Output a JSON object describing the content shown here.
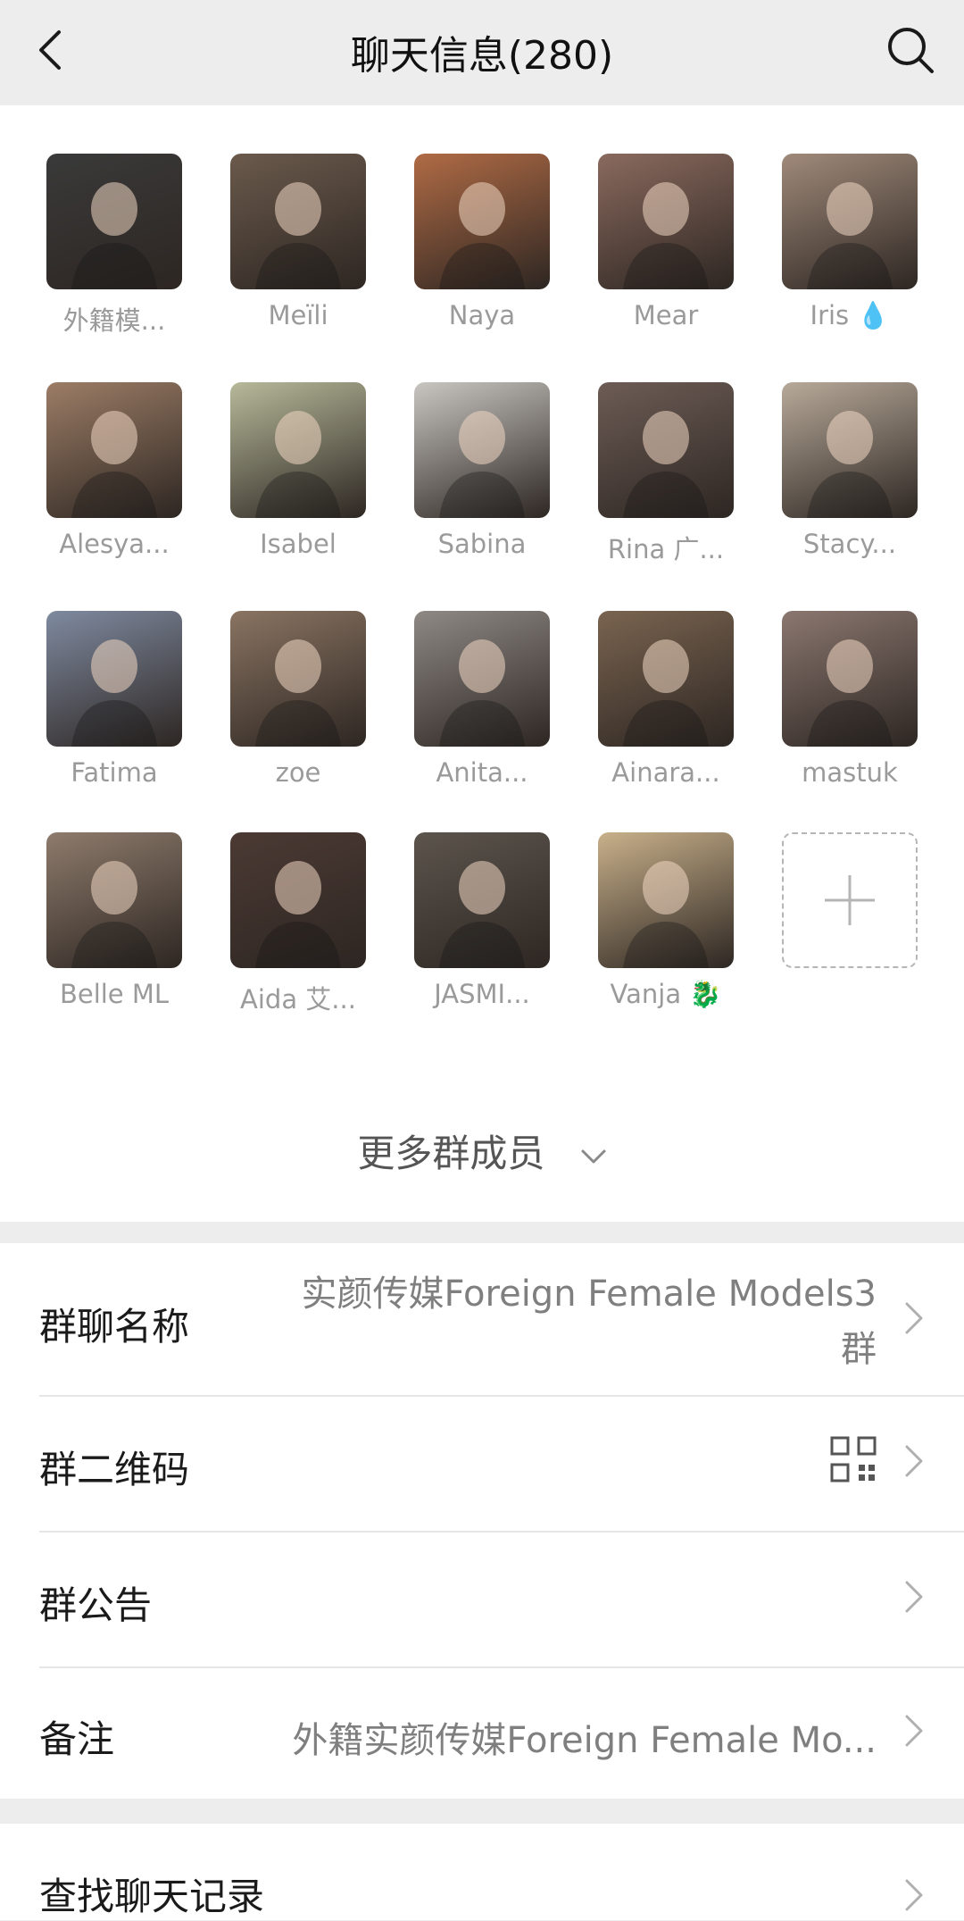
{
  "header": {
    "title": "聊天信息(280)"
  },
  "members": [
    {
      "name": "外籍模...",
      "color": "#3a3a3a"
    },
    {
      "name": "Meïli",
      "color": "#6b5a4c"
    },
    {
      "name": "Naya",
      "color": "#b06b45"
    },
    {
      "name": "Mear",
      "color": "#8a6a5e"
    },
    {
      "name": "Iris 💧",
      "color": "#a08a7a"
    },
    {
      "name": "Alesya...",
      "color": "#9c7d66"
    },
    {
      "name": "Isabel",
      "color": "#b7b99a"
    },
    {
      "name": "Sabina",
      "color": "#c9c6c2"
    },
    {
      "name": "Rina 广...",
      "color": "#6d5c55"
    },
    {
      "name": "Stacy...",
      "color": "#b8aa9a"
    },
    {
      "name": "Fatima",
      "color": "#7f8aa0"
    },
    {
      "name": "zoe",
      "color": "#8a7462"
    },
    {
      "name": "Anita...",
      "color": "#8f8985"
    },
    {
      "name": "Ainara...",
      "color": "#7a6450"
    },
    {
      "name": "mastuk",
      "color": "#8b7770"
    },
    {
      "name": "Belle ML",
      "color": "#8e7b6c"
    },
    {
      "name": "Aida 艾...",
      "color": "#4c3a34"
    },
    {
      "name": "JASMI...",
      "color": "#5c554d"
    },
    {
      "name": "Vanja 🐉",
      "color": "#c8b08a"
    }
  ],
  "more_members": "更多群成员",
  "settings": {
    "group_name_label": "群聊名称",
    "group_name_value_line1": "实颜传媒Foreign Female Models3",
    "group_name_value_line2": "群",
    "qr_label": "群二维码",
    "notice_label": "群公告",
    "remark_label": "备注",
    "remark_value": "外籍实颜传媒Foreign Female Mo..."
  },
  "search_history_label": "查找聊天记录"
}
